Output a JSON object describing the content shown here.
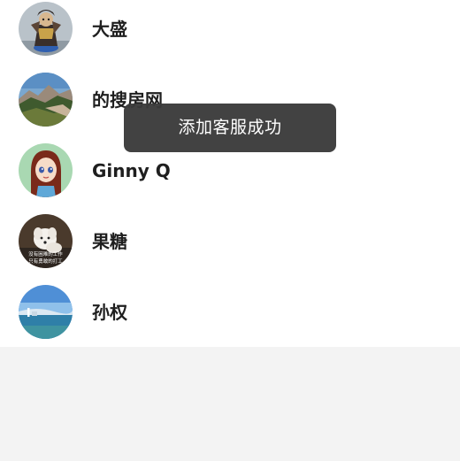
{
  "contacts": [
    {
      "name": "大盛",
      "avatar": "warrior-figurine-avatar"
    },
    {
      "name": "的搜房网",
      "avatar": "mountain-landscape-avatar"
    },
    {
      "name": "Ginny Q",
      "avatar": "cartoon-girl-avatar"
    },
    {
      "name": "果糖",
      "avatar": "white-puppy-avatar",
      "avatar_caption": [
        "没有困难的工作",
        "只有勇敢的打工"
      ]
    },
    {
      "name": "孙权",
      "avatar": "seaside-lighthouse-avatar"
    }
  ],
  "toast": {
    "message": "添加客服成功"
  },
  "colors": {
    "list_background": "#ffffff",
    "page_background": "#f3f3f3",
    "toast_background": "#3a3a3a",
    "name_text": "#1f1f1f"
  }
}
